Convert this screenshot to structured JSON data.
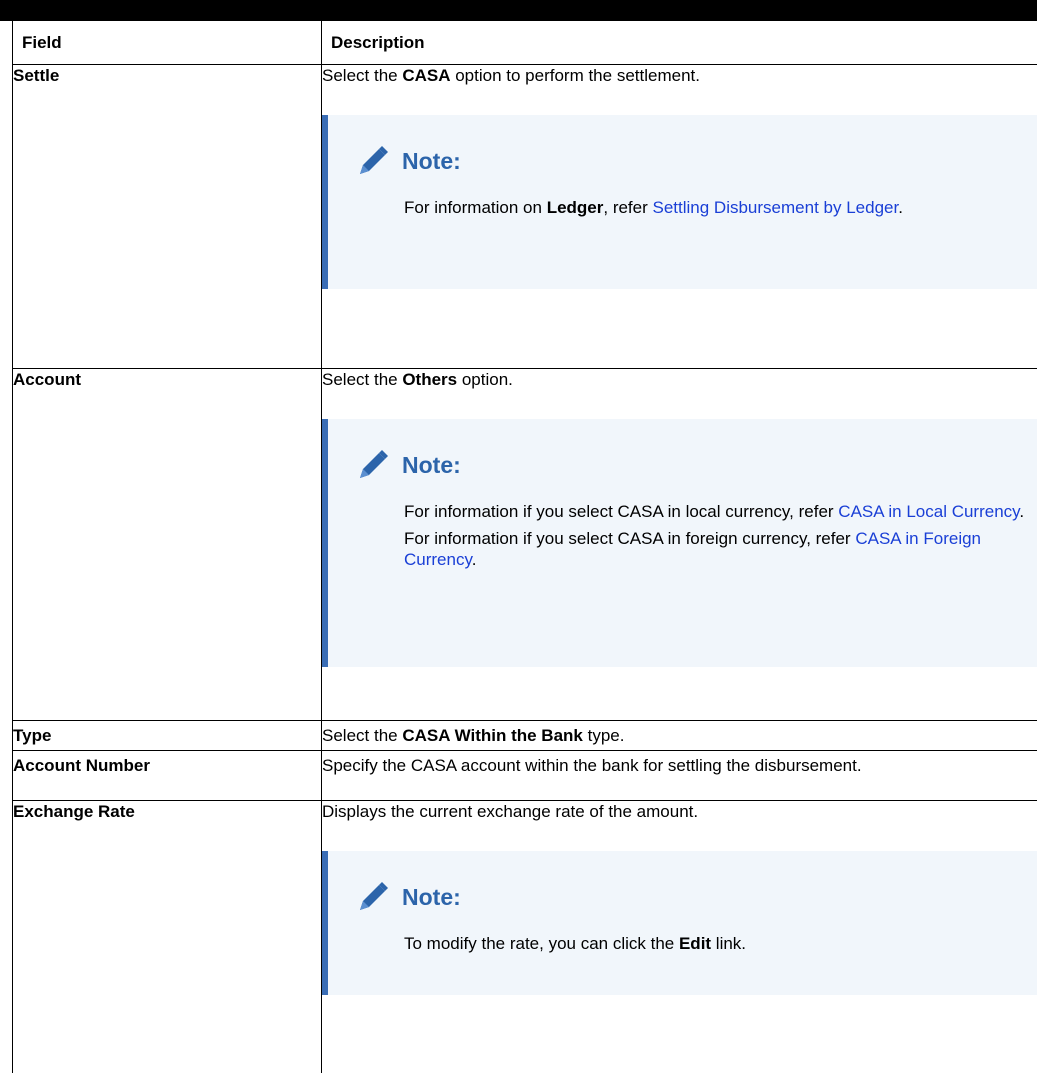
{
  "table": {
    "header": {
      "field": "Field",
      "description": "Description"
    },
    "rows": [
      {
        "field": "Settle",
        "desc": {
          "pre": "Select the ",
          "bold": "CASA",
          "post": " option to perform the settlement."
        },
        "note": {
          "title": "Note:",
          "lines": [
            {
              "pre": "For information on ",
              "bold": "Ledger",
              "mid": ", refer ",
              "link": "Settling Disbursement by Ledger",
              "post": "."
            }
          ]
        }
      },
      {
        "field": "Account",
        "desc": {
          "pre": "Select the ",
          "bold": "Others",
          "post": " option."
        },
        "note": {
          "title": "Note:",
          "lines": [
            {
              "pre": "For information if you select CASA in local currency, refer ",
              "link": "CASA in Local Currency",
              "post": "."
            },
            {
              "pre": "For information if you select CASA in foreign currency, refer ",
              "link": "CASA in Foreign Currency",
              "post": "."
            }
          ]
        }
      },
      {
        "field": "Type",
        "desc": {
          "pre": "Select the ",
          "bold": "CASA Within the Bank",
          "post": " type."
        }
      },
      {
        "field": "Account Number",
        "desc": {
          "pre": "Specify the CASA account within the bank for settling the disbursement."
        }
      },
      {
        "field": "Exchange Rate",
        "desc": {
          "pre": "Displays the current exchange rate of the amount."
        },
        "note": {
          "title": "Note:",
          "lines": [
            {
              "pre": "To modify the rate, you can click the ",
              "bold": "Edit",
              "post": " link."
            }
          ]
        }
      }
    ]
  },
  "icons": {
    "note_icon": "pencil-icon"
  },
  "colors": {
    "note_accent": "#3a6db5",
    "note_title": "#2c64aa",
    "link": "#1a3fd6",
    "note_bg": "#f1f6fb"
  }
}
